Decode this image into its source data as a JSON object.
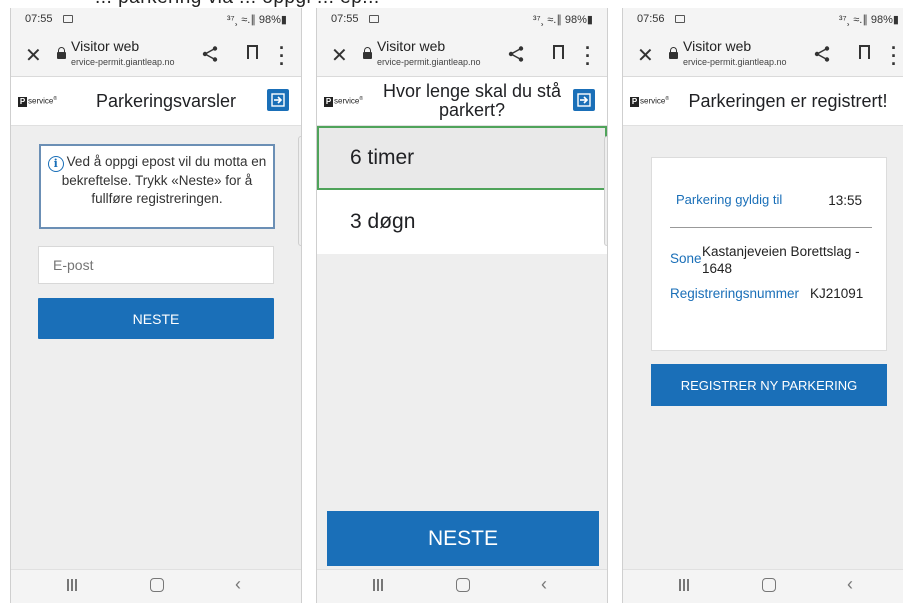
{
  "caption": "... parkering via ... oppgi ... ep...",
  "screens": [
    {
      "status": {
        "time": "07:55",
        "signal": "³⁷¸ ≈.∥ 98%▮"
      },
      "browser": {
        "title": "Visitor web",
        "url": "ervice-permit.giantleap.no"
      },
      "logo": "service",
      "header_title": "Parkeringsvarsler",
      "info_text": "Ved å oppgi epost vil du motta en bekreftelse. Trykk «Neste» for å fullføre registreringen.",
      "email_placeholder": "E-post",
      "button_label": "NESTE"
    },
    {
      "status": {
        "time": "07:55",
        "signal": "³⁷¸ ≈.∥ 98%▮"
      },
      "browser": {
        "title": "Visitor web",
        "url": "ervice-permit.giantleap.no"
      },
      "logo": "service",
      "header_title": "Hvor lenge skal du stå parkert?",
      "options": [
        "6 timer",
        "3 døgn"
      ],
      "selected_option": "6 timer",
      "button_label": "NESTE"
    },
    {
      "status": {
        "time": "07:56",
        "signal": "³⁷¸ ≈.∥ 98%▮"
      },
      "browser": {
        "title": "Visitor web",
        "url": "ervice-permit.giantleap.no"
      },
      "logo": "service",
      "header_title": "Parkeringen er registrert!",
      "valid_label": "Parkering gyldig til",
      "valid_value": "13:55",
      "zone_label": "Sone",
      "zone_value": "Kastanjeveien Borettslag - 1648",
      "reg_label": "Registreringsnummer",
      "reg_value": "KJ21091",
      "button_label": "REGISTRER NY PARKERING"
    }
  ],
  "colors": {
    "primary": "#1a6fb8",
    "selected_border": "#4fa35a",
    "background": "#eeeeee"
  },
  "icons": {
    "close": "close-icon",
    "lock": "lock-icon",
    "share": "share-icon",
    "bookmark": "bookmark-icon",
    "menu": "more-vert-icon",
    "logout": "logout-icon",
    "info": "info-icon"
  }
}
